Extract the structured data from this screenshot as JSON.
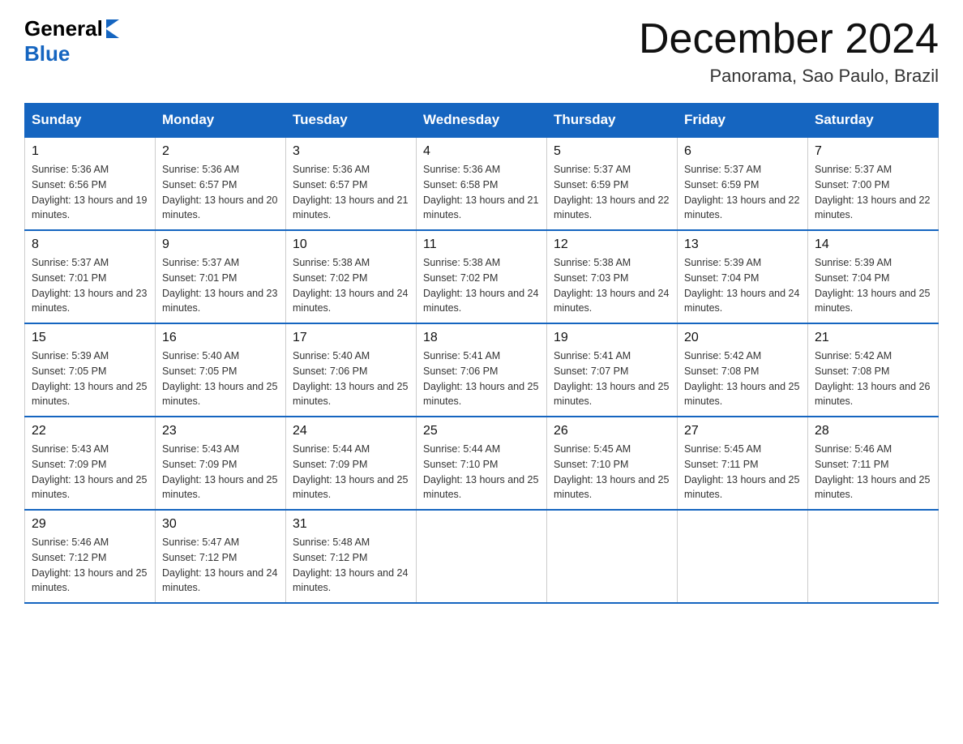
{
  "logo": {
    "text_general": "General",
    "text_blue": "Blue",
    "arrow_symbol": "▶"
  },
  "title": "December 2024",
  "subtitle": "Panorama, Sao Paulo, Brazil",
  "header_row": [
    "Sunday",
    "Monday",
    "Tuesday",
    "Wednesday",
    "Thursday",
    "Friday",
    "Saturday"
  ],
  "weeks": [
    [
      {
        "num": "1",
        "sunrise": "5:36 AM",
        "sunset": "6:56 PM",
        "daylight": "13 hours and 19 minutes."
      },
      {
        "num": "2",
        "sunrise": "5:36 AM",
        "sunset": "6:57 PM",
        "daylight": "13 hours and 20 minutes."
      },
      {
        "num": "3",
        "sunrise": "5:36 AM",
        "sunset": "6:57 PM",
        "daylight": "13 hours and 21 minutes."
      },
      {
        "num": "4",
        "sunrise": "5:36 AM",
        "sunset": "6:58 PM",
        "daylight": "13 hours and 21 minutes."
      },
      {
        "num": "5",
        "sunrise": "5:37 AM",
        "sunset": "6:59 PM",
        "daylight": "13 hours and 22 minutes."
      },
      {
        "num": "6",
        "sunrise": "5:37 AM",
        "sunset": "6:59 PM",
        "daylight": "13 hours and 22 minutes."
      },
      {
        "num": "7",
        "sunrise": "5:37 AM",
        "sunset": "7:00 PM",
        "daylight": "13 hours and 22 minutes."
      }
    ],
    [
      {
        "num": "8",
        "sunrise": "5:37 AM",
        "sunset": "7:01 PM",
        "daylight": "13 hours and 23 minutes."
      },
      {
        "num": "9",
        "sunrise": "5:37 AM",
        "sunset": "7:01 PM",
        "daylight": "13 hours and 23 minutes."
      },
      {
        "num": "10",
        "sunrise": "5:38 AM",
        "sunset": "7:02 PM",
        "daylight": "13 hours and 24 minutes."
      },
      {
        "num": "11",
        "sunrise": "5:38 AM",
        "sunset": "7:02 PM",
        "daylight": "13 hours and 24 minutes."
      },
      {
        "num": "12",
        "sunrise": "5:38 AM",
        "sunset": "7:03 PM",
        "daylight": "13 hours and 24 minutes."
      },
      {
        "num": "13",
        "sunrise": "5:39 AM",
        "sunset": "7:04 PM",
        "daylight": "13 hours and 24 minutes."
      },
      {
        "num": "14",
        "sunrise": "5:39 AM",
        "sunset": "7:04 PM",
        "daylight": "13 hours and 25 minutes."
      }
    ],
    [
      {
        "num": "15",
        "sunrise": "5:39 AM",
        "sunset": "7:05 PM",
        "daylight": "13 hours and 25 minutes."
      },
      {
        "num": "16",
        "sunrise": "5:40 AM",
        "sunset": "7:05 PM",
        "daylight": "13 hours and 25 minutes."
      },
      {
        "num": "17",
        "sunrise": "5:40 AM",
        "sunset": "7:06 PM",
        "daylight": "13 hours and 25 minutes."
      },
      {
        "num": "18",
        "sunrise": "5:41 AM",
        "sunset": "7:06 PM",
        "daylight": "13 hours and 25 minutes."
      },
      {
        "num": "19",
        "sunrise": "5:41 AM",
        "sunset": "7:07 PM",
        "daylight": "13 hours and 25 minutes."
      },
      {
        "num": "20",
        "sunrise": "5:42 AM",
        "sunset": "7:08 PM",
        "daylight": "13 hours and 25 minutes."
      },
      {
        "num": "21",
        "sunrise": "5:42 AM",
        "sunset": "7:08 PM",
        "daylight": "13 hours and 26 minutes."
      }
    ],
    [
      {
        "num": "22",
        "sunrise": "5:43 AM",
        "sunset": "7:09 PM",
        "daylight": "13 hours and 25 minutes."
      },
      {
        "num": "23",
        "sunrise": "5:43 AM",
        "sunset": "7:09 PM",
        "daylight": "13 hours and 25 minutes."
      },
      {
        "num": "24",
        "sunrise": "5:44 AM",
        "sunset": "7:09 PM",
        "daylight": "13 hours and 25 minutes."
      },
      {
        "num": "25",
        "sunrise": "5:44 AM",
        "sunset": "7:10 PM",
        "daylight": "13 hours and 25 minutes."
      },
      {
        "num": "26",
        "sunrise": "5:45 AM",
        "sunset": "7:10 PM",
        "daylight": "13 hours and 25 minutes."
      },
      {
        "num": "27",
        "sunrise": "5:45 AM",
        "sunset": "7:11 PM",
        "daylight": "13 hours and 25 minutes."
      },
      {
        "num": "28",
        "sunrise": "5:46 AM",
        "sunset": "7:11 PM",
        "daylight": "13 hours and 25 minutes."
      }
    ],
    [
      {
        "num": "29",
        "sunrise": "5:46 AM",
        "sunset": "7:12 PM",
        "daylight": "13 hours and 25 minutes."
      },
      {
        "num": "30",
        "sunrise": "5:47 AM",
        "sunset": "7:12 PM",
        "daylight": "13 hours and 24 minutes."
      },
      {
        "num": "31",
        "sunrise": "5:48 AM",
        "sunset": "7:12 PM",
        "daylight": "13 hours and 24 minutes."
      },
      null,
      null,
      null,
      null
    ]
  ]
}
